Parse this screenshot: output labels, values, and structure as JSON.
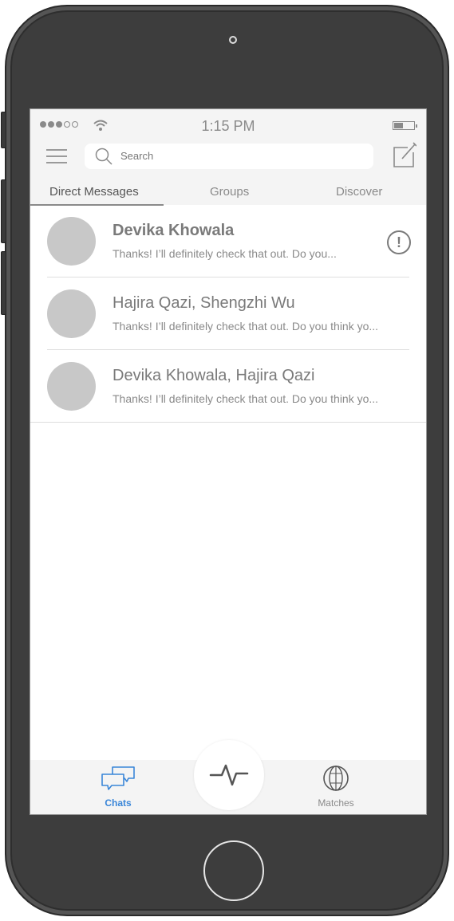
{
  "status_bar": {
    "time": "1:15 PM"
  },
  "header": {
    "search_placeholder": "Search"
  },
  "tabs": [
    {
      "label": "Direct Messages",
      "active": true
    },
    {
      "label": "Groups",
      "active": false
    },
    {
      "label": "Discover",
      "active": false
    }
  ],
  "conversations": [
    {
      "name": "Devika Khowala",
      "preview": "Thanks! I’ll definitely check that out. Do you...",
      "unread": true,
      "alert_icon": "exclamation-circle-icon"
    },
    {
      "name": "Hajira Qazi, Shengzhi Wu",
      "preview": "Thanks! I’ll definitely check that out. Do you think yo...",
      "unread": false
    },
    {
      "name": "Devika Khowala, Hajira Qazi",
      "preview": "Thanks! I’ll definitely check that out. Do you think yo...",
      "unread": false
    }
  ],
  "bottom_nav": {
    "chats_label": "Chats",
    "matches_label": "Matches",
    "active": "Chats",
    "center_icon": "pulse-icon"
  },
  "colors": {
    "accent": "#3a86d8",
    "phone_body": "#3d3d3d",
    "avatar": "#c8c8c8",
    "text_gray": "#8a8a8a"
  },
  "icons": [
    "signal-dots-icon",
    "wifi-icon",
    "battery-icon",
    "hamburger-menu-icon",
    "search-icon",
    "compose-icon",
    "chat-bubbles-icon",
    "pulse-icon",
    "globe-icon"
  ]
}
